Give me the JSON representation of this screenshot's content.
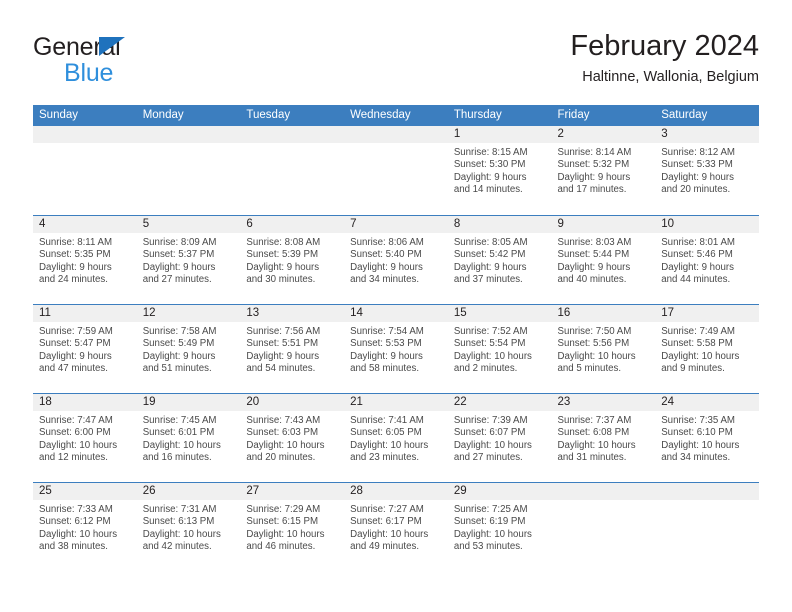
{
  "brand": {
    "line1": "General",
    "line2": "Blue",
    "triangle_color": "#1f72bd",
    "blue_text_color": "#2f8fdc"
  },
  "header": {
    "title": "February 2024",
    "location": "Haltinne, Wallonia, Belgium"
  },
  "theme": {
    "header_blue": "#3c7ebf",
    "day_band_gray": "#f0f0f0",
    "text_dark": "#231f20",
    "text_body": "#4a4a4a"
  },
  "weekdays": [
    "Sunday",
    "Monday",
    "Tuesday",
    "Wednesday",
    "Thursday",
    "Friday",
    "Saturday"
  ],
  "weeks": [
    [
      {
        "day": "",
        "sunrise": "",
        "sunset": "",
        "daylight1": "",
        "daylight2": ""
      },
      {
        "day": "",
        "sunrise": "",
        "sunset": "",
        "daylight1": "",
        "daylight2": ""
      },
      {
        "day": "",
        "sunrise": "",
        "sunset": "",
        "daylight1": "",
        "daylight2": ""
      },
      {
        "day": "",
        "sunrise": "",
        "sunset": "",
        "daylight1": "",
        "daylight2": ""
      },
      {
        "day": "1",
        "sunrise": "Sunrise: 8:15 AM",
        "sunset": "Sunset: 5:30 PM",
        "daylight1": "Daylight: 9 hours",
        "daylight2": "and 14 minutes."
      },
      {
        "day": "2",
        "sunrise": "Sunrise: 8:14 AM",
        "sunset": "Sunset: 5:32 PM",
        "daylight1": "Daylight: 9 hours",
        "daylight2": "and 17 minutes."
      },
      {
        "day": "3",
        "sunrise": "Sunrise: 8:12 AM",
        "sunset": "Sunset: 5:33 PM",
        "daylight1": "Daylight: 9 hours",
        "daylight2": "and 20 minutes."
      }
    ],
    [
      {
        "day": "4",
        "sunrise": "Sunrise: 8:11 AM",
        "sunset": "Sunset: 5:35 PM",
        "daylight1": "Daylight: 9 hours",
        "daylight2": "and 24 minutes."
      },
      {
        "day": "5",
        "sunrise": "Sunrise: 8:09 AM",
        "sunset": "Sunset: 5:37 PM",
        "daylight1": "Daylight: 9 hours",
        "daylight2": "and 27 minutes."
      },
      {
        "day": "6",
        "sunrise": "Sunrise: 8:08 AM",
        "sunset": "Sunset: 5:39 PM",
        "daylight1": "Daylight: 9 hours",
        "daylight2": "and 30 minutes."
      },
      {
        "day": "7",
        "sunrise": "Sunrise: 8:06 AM",
        "sunset": "Sunset: 5:40 PM",
        "daylight1": "Daylight: 9 hours",
        "daylight2": "and 34 minutes."
      },
      {
        "day": "8",
        "sunrise": "Sunrise: 8:05 AM",
        "sunset": "Sunset: 5:42 PM",
        "daylight1": "Daylight: 9 hours",
        "daylight2": "and 37 minutes."
      },
      {
        "day": "9",
        "sunrise": "Sunrise: 8:03 AM",
        "sunset": "Sunset: 5:44 PM",
        "daylight1": "Daylight: 9 hours",
        "daylight2": "and 40 minutes."
      },
      {
        "day": "10",
        "sunrise": "Sunrise: 8:01 AM",
        "sunset": "Sunset: 5:46 PM",
        "daylight1": "Daylight: 9 hours",
        "daylight2": "and 44 minutes."
      }
    ],
    [
      {
        "day": "11",
        "sunrise": "Sunrise: 7:59 AM",
        "sunset": "Sunset: 5:47 PM",
        "daylight1": "Daylight: 9 hours",
        "daylight2": "and 47 minutes."
      },
      {
        "day": "12",
        "sunrise": "Sunrise: 7:58 AM",
        "sunset": "Sunset: 5:49 PM",
        "daylight1": "Daylight: 9 hours",
        "daylight2": "and 51 minutes."
      },
      {
        "day": "13",
        "sunrise": "Sunrise: 7:56 AM",
        "sunset": "Sunset: 5:51 PM",
        "daylight1": "Daylight: 9 hours",
        "daylight2": "and 54 minutes."
      },
      {
        "day": "14",
        "sunrise": "Sunrise: 7:54 AM",
        "sunset": "Sunset: 5:53 PM",
        "daylight1": "Daylight: 9 hours",
        "daylight2": "and 58 minutes."
      },
      {
        "day": "15",
        "sunrise": "Sunrise: 7:52 AM",
        "sunset": "Sunset: 5:54 PM",
        "daylight1": "Daylight: 10 hours",
        "daylight2": "and 2 minutes."
      },
      {
        "day": "16",
        "sunrise": "Sunrise: 7:50 AM",
        "sunset": "Sunset: 5:56 PM",
        "daylight1": "Daylight: 10 hours",
        "daylight2": "and 5 minutes."
      },
      {
        "day": "17",
        "sunrise": "Sunrise: 7:49 AM",
        "sunset": "Sunset: 5:58 PM",
        "daylight1": "Daylight: 10 hours",
        "daylight2": "and 9 minutes."
      }
    ],
    [
      {
        "day": "18",
        "sunrise": "Sunrise: 7:47 AM",
        "sunset": "Sunset: 6:00 PM",
        "daylight1": "Daylight: 10 hours",
        "daylight2": "and 12 minutes."
      },
      {
        "day": "19",
        "sunrise": "Sunrise: 7:45 AM",
        "sunset": "Sunset: 6:01 PM",
        "daylight1": "Daylight: 10 hours",
        "daylight2": "and 16 minutes."
      },
      {
        "day": "20",
        "sunrise": "Sunrise: 7:43 AM",
        "sunset": "Sunset: 6:03 PM",
        "daylight1": "Daylight: 10 hours",
        "daylight2": "and 20 minutes."
      },
      {
        "day": "21",
        "sunrise": "Sunrise: 7:41 AM",
        "sunset": "Sunset: 6:05 PM",
        "daylight1": "Daylight: 10 hours",
        "daylight2": "and 23 minutes."
      },
      {
        "day": "22",
        "sunrise": "Sunrise: 7:39 AM",
        "sunset": "Sunset: 6:07 PM",
        "daylight1": "Daylight: 10 hours",
        "daylight2": "and 27 minutes."
      },
      {
        "day": "23",
        "sunrise": "Sunrise: 7:37 AM",
        "sunset": "Sunset: 6:08 PM",
        "daylight1": "Daylight: 10 hours",
        "daylight2": "and 31 minutes."
      },
      {
        "day": "24",
        "sunrise": "Sunrise: 7:35 AM",
        "sunset": "Sunset: 6:10 PM",
        "daylight1": "Daylight: 10 hours",
        "daylight2": "and 34 minutes."
      }
    ],
    [
      {
        "day": "25",
        "sunrise": "Sunrise: 7:33 AM",
        "sunset": "Sunset: 6:12 PM",
        "daylight1": "Daylight: 10 hours",
        "daylight2": "and 38 minutes."
      },
      {
        "day": "26",
        "sunrise": "Sunrise: 7:31 AM",
        "sunset": "Sunset: 6:13 PM",
        "daylight1": "Daylight: 10 hours",
        "daylight2": "and 42 minutes."
      },
      {
        "day": "27",
        "sunrise": "Sunrise: 7:29 AM",
        "sunset": "Sunset: 6:15 PM",
        "daylight1": "Daylight: 10 hours",
        "daylight2": "and 46 minutes."
      },
      {
        "day": "28",
        "sunrise": "Sunrise: 7:27 AM",
        "sunset": "Sunset: 6:17 PM",
        "daylight1": "Daylight: 10 hours",
        "daylight2": "and 49 minutes."
      },
      {
        "day": "29",
        "sunrise": "Sunrise: 7:25 AM",
        "sunset": "Sunset: 6:19 PM",
        "daylight1": "Daylight: 10 hours",
        "daylight2": "and 53 minutes."
      },
      {
        "day": "",
        "sunrise": "",
        "sunset": "",
        "daylight1": "",
        "daylight2": ""
      },
      {
        "day": "",
        "sunrise": "",
        "sunset": "",
        "daylight1": "",
        "daylight2": ""
      }
    ]
  ]
}
